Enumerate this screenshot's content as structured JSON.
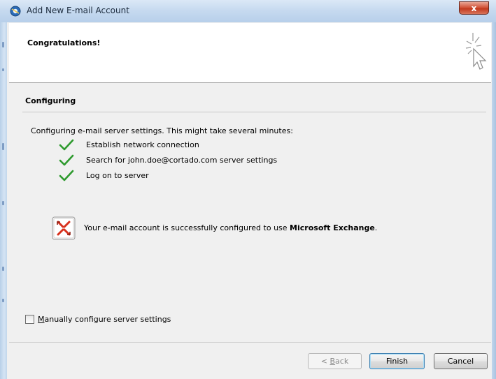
{
  "window": {
    "title": "Add New E-mail Account",
    "close_symbol": "x"
  },
  "header": {
    "title": "Congratulations!",
    "icon": "wizard-cursor-icon"
  },
  "section": {
    "title": "Configuring",
    "intro": "Configuring e-mail server settings. This might take several minutes:"
  },
  "steps": [
    {
      "label": "Establish network connection",
      "status": "done"
    },
    {
      "label": "Search for john.doe@cortado.com server settings",
      "status": "done"
    },
    {
      "label": "Log on to server",
      "status": "done"
    }
  ],
  "result": {
    "icon": "exchange-icon",
    "text_prefix": "Your e-mail account is successfully configured to use ",
    "text_product": "Microsoft Exchange",
    "text_suffix": "."
  },
  "manual": {
    "accel": "M",
    "label_rest": "anually configure server settings",
    "checked": false
  },
  "buttons": {
    "back_prefix": "< ",
    "back_accel": "B",
    "back_rest": "ack",
    "finish": "Finish",
    "cancel": "Cancel"
  },
  "colors": {
    "check": "#2e9a2e",
    "exchange_red": "#d8311d",
    "close_red": "#c23a1e"
  }
}
